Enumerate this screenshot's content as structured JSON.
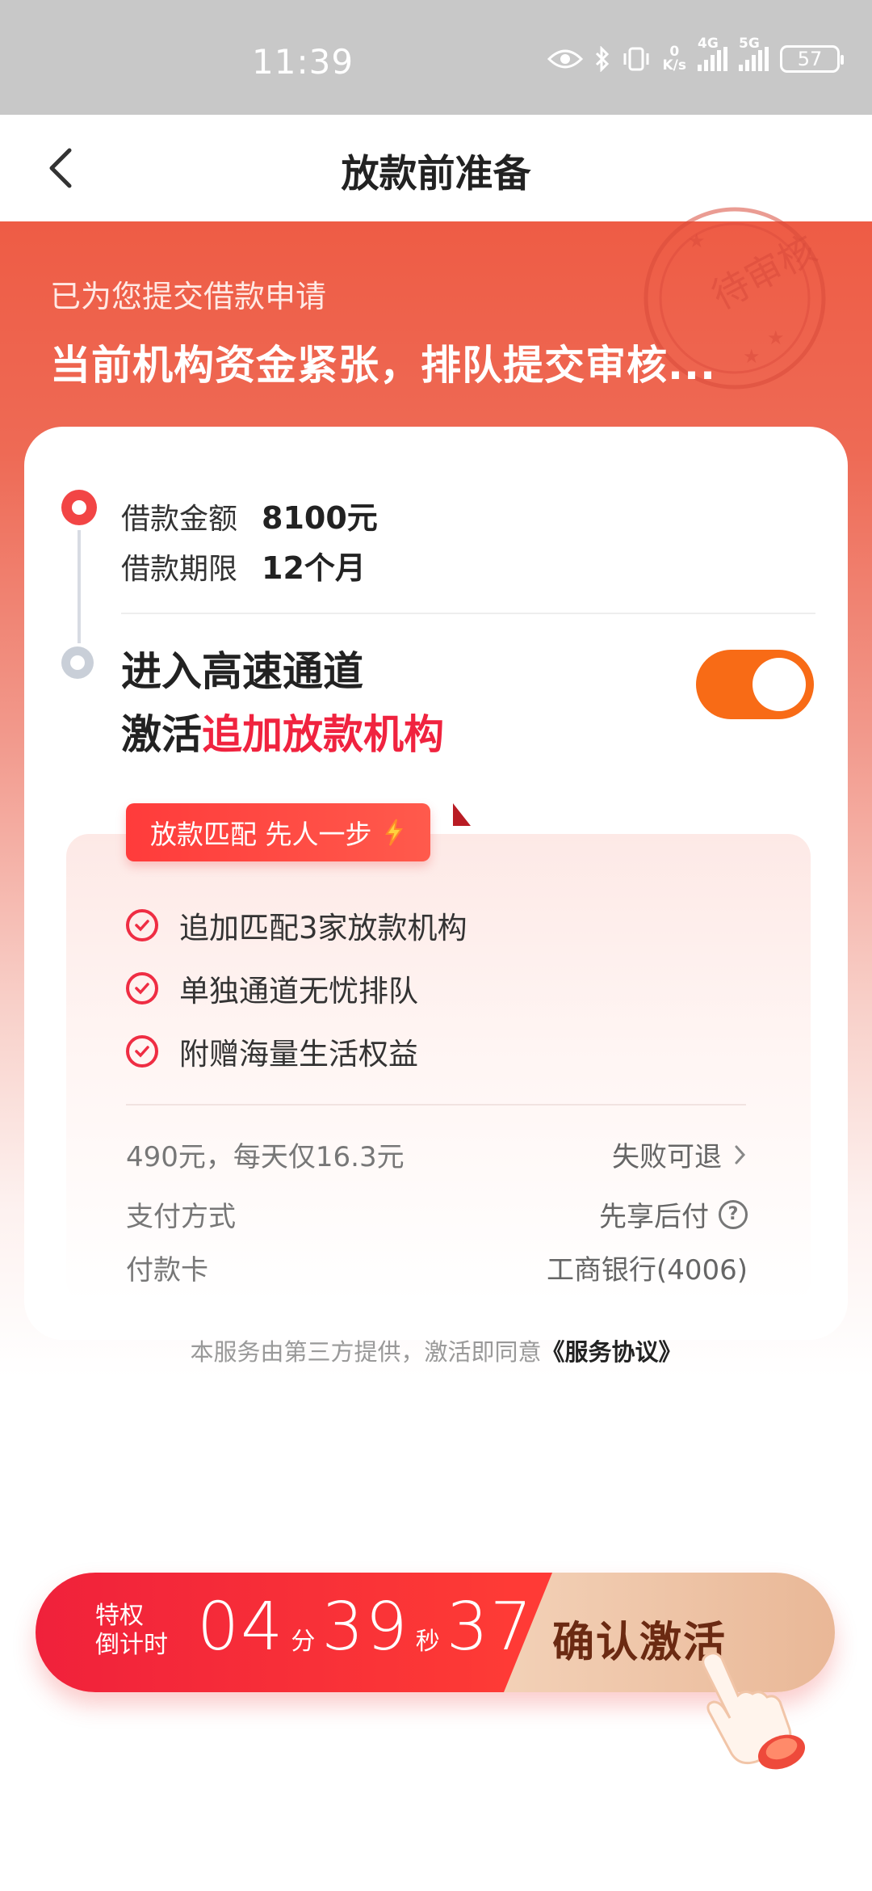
{
  "status_bar": {
    "time": "11:39",
    "net_speed_value": "0",
    "net_speed_unit": "K/s",
    "net_4g": "4G",
    "net_5g": "5G",
    "battery": "57"
  },
  "nav": {
    "title": "放款前准备"
  },
  "hero": {
    "subtitle": "已为您提交借款申请",
    "headline": "当前机构资金紧张，排队提交审核...",
    "stamp_text": "待审核"
  },
  "loan": {
    "amount_label": "借款金额",
    "amount_value": "8100元",
    "term_label": "借款期限",
    "term_value": "12个月"
  },
  "fast_channel": {
    "line1": "进入高速通道",
    "line2_prefix": "激活",
    "line2_highlight": "追加放款机构",
    "toggle_on": true
  },
  "benefits": {
    "tag": "放款匹配 先人一步",
    "items": [
      "追加匹配3家放款机构",
      "单独通道无忧排队",
      "附赠海量生活权益"
    ]
  },
  "pricing": {
    "price_text": "490元，每天仅16.3元",
    "refund_text": "失败可退",
    "pay_method_label": "支付方式",
    "pay_method_value": "先享后付",
    "card_label": "付款卡",
    "card_value": "工商银行(4006)"
  },
  "agreement": {
    "text": "本服务由第三方提供，激活即同意",
    "link": "《服务协议》"
  },
  "cta": {
    "label_line1": "特权",
    "label_line2": "倒计时",
    "minutes": "04",
    "min_unit": "分",
    "seconds": "39",
    "sec_unit": "秒",
    "hundredths": "37",
    "confirm": "确认激活"
  },
  "colors": {
    "brand_red": "#f0233f",
    "toggle_orange": "#f86b16",
    "hero_red": "#ee5c45",
    "confirm_text": "#6b2a12"
  }
}
